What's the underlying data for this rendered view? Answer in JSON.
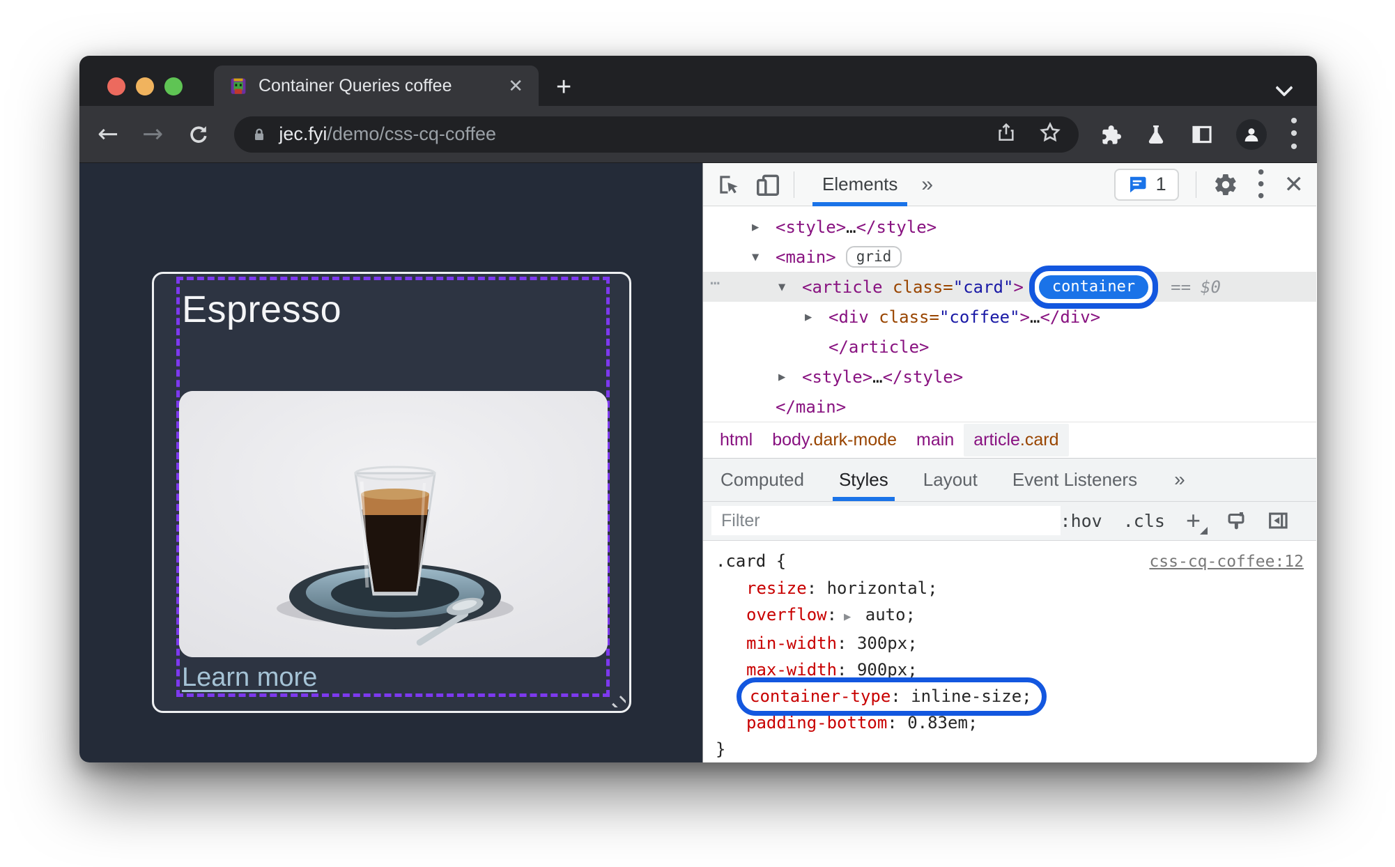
{
  "browser": {
    "tab_title": "Container Queries coffee",
    "close_tab_glyph": "✕",
    "new_tab_glyph": "+",
    "url": {
      "domain": "jec.fyi",
      "path": "/demo/css-cq-coffee"
    }
  },
  "page": {
    "card_title": "Espresso",
    "card_link": "Learn more"
  },
  "devtools": {
    "panel_tab": "Elements",
    "more_tabs_glyph": "»",
    "issues_count": "1",
    "menu_dots_glyph": "⋮",
    "close_glyph": "✕",
    "dom_rows": [
      {
        "level": 1,
        "arrow": "▶",
        "tokens": [
          {
            "t": "tag",
            "v": "<style>"
          },
          {
            "t": "plain",
            "v": "…"
          },
          {
            "t": "tag",
            "v": "</style>"
          }
        ]
      },
      {
        "level": 1,
        "arrow": "▼",
        "tokens": [
          {
            "t": "tag",
            "v": "<main>"
          },
          {
            "t": "badge-grid",
            "v": "grid"
          }
        ]
      },
      {
        "level": 2,
        "arrow": "▼",
        "selected": true,
        "gutter": "⋯",
        "tokens": [
          {
            "t": "tag",
            "v": "<article"
          },
          {
            "t": "attr",
            "v": " class="
          },
          {
            "t": "val",
            "v": "\"card\""
          },
          {
            "t": "tag",
            "v": ">"
          },
          {
            "t": "badge-container",
            "v": "container"
          },
          {
            "t": "eq",
            "v": "=="
          },
          {
            "t": "dollar",
            "v": "$0"
          }
        ]
      },
      {
        "level": 3,
        "arrow": "▶",
        "tokens": [
          {
            "t": "tag",
            "v": "<div"
          },
          {
            "t": "attr",
            "v": " class="
          },
          {
            "t": "val",
            "v": "\"coffee\""
          },
          {
            "t": "tag",
            "v": ">"
          },
          {
            "t": "plain",
            "v": "…"
          },
          {
            "t": "tag",
            "v": "</div>"
          }
        ]
      },
      {
        "level": 3,
        "arrow": "",
        "tokens": [
          {
            "t": "tag",
            "v": "</article>"
          }
        ]
      },
      {
        "level": 2,
        "arrow": "▶",
        "tokens": [
          {
            "t": "tag",
            "v": "<style>"
          },
          {
            "t": "plain",
            "v": "…"
          },
          {
            "t": "tag",
            "v": "</style>"
          }
        ]
      },
      {
        "level": 1,
        "arrow": "",
        "tokens": [
          {
            "t": "tag",
            "v": "</main>"
          }
        ]
      }
    ],
    "breadcrumbs": [
      {
        "tag": "html",
        "cls": "",
        "selected": false
      },
      {
        "tag": "body",
        "cls": ".dark-mode",
        "selected": false
      },
      {
        "tag": "main",
        "cls": "",
        "selected": false
      },
      {
        "tag": "article",
        "cls": ".card",
        "selected": true
      }
    ],
    "sidebar_tabs": [
      {
        "label": "Computed",
        "active": false
      },
      {
        "label": "Styles",
        "active": true
      },
      {
        "label": "Layout",
        "active": false
      },
      {
        "label": "Event Listeners",
        "active": false
      }
    ],
    "filter_placeholder": "Filter",
    "hov_label": ":hov",
    "cls_label": ".cls",
    "plus_glyph": "+",
    "rule": {
      "selector": ".card",
      "open_brace": "{",
      "close_brace": "}",
      "source_link": "css-cq-coffee:12",
      "properties": [
        {
          "name": "resize",
          "value": "horizontal",
          "expandable": false,
          "highlighted": false
        },
        {
          "name": "overflow",
          "value": "auto",
          "expandable": true,
          "highlighted": false
        },
        {
          "name": "min-width",
          "value": "300px",
          "expandable": false,
          "highlighted": false
        },
        {
          "name": "max-width",
          "value": "900px",
          "expandable": false,
          "highlighted": false
        },
        {
          "name": "container-type",
          "value": "inline-size",
          "expandable": false,
          "highlighted": true
        },
        {
          "name": "padding-bottom",
          "value": "0.83em",
          "expandable": false,
          "highlighted": false
        }
      ]
    }
  },
  "colors": {
    "accent_blue": "#1a73e8",
    "annotation_ring_blue": "#1357df",
    "container_overlay_purple": "#7d39ee",
    "css_property_red": "#c80000",
    "dom_tag_purple": "#881280",
    "dom_attr_orange": "#994500",
    "dom_value_blue": "#1a1aa6",
    "page_background": "#242b38",
    "card_background": "#2d3442",
    "link_blue": "#a5c3d6"
  }
}
